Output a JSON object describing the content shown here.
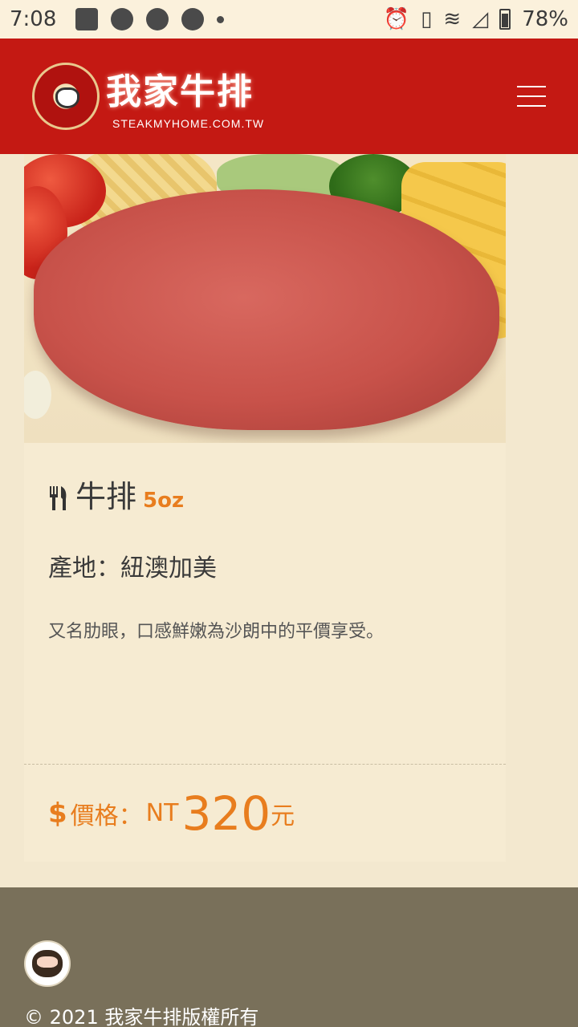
{
  "status_bar": {
    "time": "7:08",
    "battery": "78%",
    "left_icons": [
      "image-icon",
      "line-icon",
      "music-icon",
      "music-icon",
      "dot-icon"
    ],
    "right_icons": [
      "alarm-icon",
      "vibrate-icon",
      "wifi-icon",
      "signal-icon",
      "battery-icon"
    ]
  },
  "header": {
    "brand_name": "我家牛排",
    "brand_url": "STEAKMYHOME.COM.TW",
    "menu_icon": "hamburger-menu-icon"
  },
  "product": {
    "image_alt": "steak-photo",
    "name": "牛排",
    "size": "5oz",
    "origin": "產地：紐澳加美",
    "description": "又名肋眼，口感鮮嫩為沙朗中的平價享受。",
    "price_label": "價格：",
    "price_currency": "NT",
    "price_value": "320",
    "price_unit": "元",
    "price_icon": "dollar-icon",
    "name_icon": "fork-knife-icon"
  },
  "footer": {
    "copyright": "© 2021 我家牛排版權所有"
  },
  "colors": {
    "header_bg": "#c41913",
    "accent_orange": "#e87d1e",
    "footer_bg": "#79705a",
    "page_bg": "#f3e8cf"
  }
}
